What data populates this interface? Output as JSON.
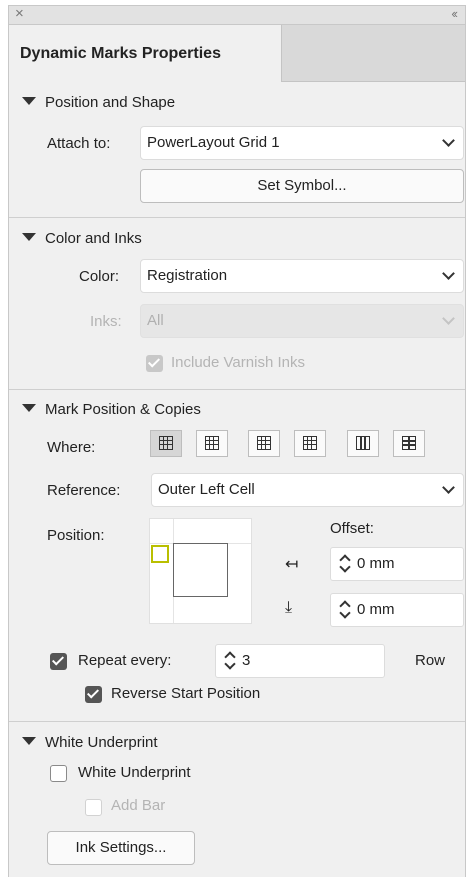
{
  "panel": {
    "title": "Dynamic Marks Properties",
    "close_glyph": "×",
    "collapse_glyph": "‹‹"
  },
  "position_shape": {
    "header": "Position and Shape",
    "attach_label": "Attach to:",
    "attach_value": "PowerLayout Grid 1",
    "set_symbol_button": "Set Symbol..."
  },
  "color_inks": {
    "header": "Color and Inks",
    "color_label": "Color:",
    "color_value": "Registration",
    "inks_label": "Inks:",
    "inks_value": "All",
    "include_varnish_label": "Include Varnish Inks",
    "include_varnish_checked": true
  },
  "mark_position": {
    "header": "Mark Position & Copies",
    "where_label": "Where:",
    "reference_label": "Reference:",
    "reference_value": "Outer Left Cell",
    "position_label": "Position:",
    "offset_label": "Offset:",
    "offset_x_icon": "align-left-arrow-icon",
    "offset_x_glyph": "↤",
    "offset_x_value": "0 mm",
    "offset_y_icon": "align-bottom-arrow-icon",
    "offset_y_glyph": "⤓",
    "offset_y_value": "0 mm",
    "repeat_label": "Repeat every:",
    "repeat_checked": true,
    "repeat_value": "3",
    "repeat_unit": "Row",
    "reverse_label": "Reverse Start Position",
    "reverse_checked": true
  },
  "white_underprint": {
    "header": "White Underprint",
    "checkbox_label": "White Underprint",
    "checked": false,
    "add_bar_label": "Add Bar",
    "add_bar_checked": false,
    "ink_settings_button": "Ink Settings..."
  },
  "colors": {
    "panel_bg": "#f0f0f0",
    "marker_accent": "#b9bf00"
  }
}
